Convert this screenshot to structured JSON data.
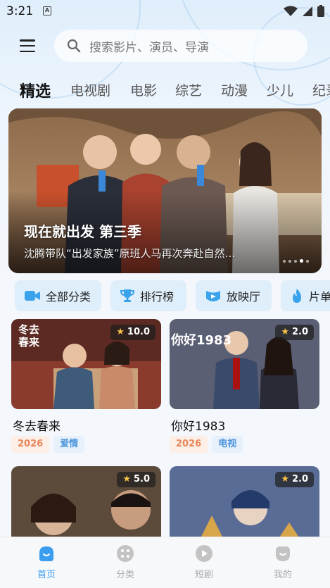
{
  "status": {
    "time": "3:21",
    "notification_badge": "A",
    "icons": [
      "wifi-icon",
      "signal-icon",
      "battery-icon"
    ]
  },
  "search": {
    "placeholder": "搜索影片、演员、导演"
  },
  "tabs": [
    {
      "label": "精选",
      "active": true
    },
    {
      "label": "电视剧"
    },
    {
      "label": "电影"
    },
    {
      "label": "综艺"
    },
    {
      "label": "动漫"
    },
    {
      "label": "少儿"
    },
    {
      "label": "纪录"
    }
  ],
  "banner": {
    "title": "现在就出发 第三季",
    "subtitle": "沈腾带队“出发家族”原班人马再次奔赴自然…",
    "slide_count": 5,
    "active_slide": 4
  },
  "quick_links": [
    {
      "label": "全部分类",
      "icon": "video-camera-icon"
    },
    {
      "label": "排行榜",
      "icon": "trophy-icon"
    },
    {
      "label": "放映厅",
      "icon": "theater-icon"
    },
    {
      "label": "片单",
      "icon": "flame-icon"
    }
  ],
  "cards": [
    {
      "title": "冬去春来",
      "rating": "10.0",
      "year": "2026",
      "genre": "爱情",
      "poster_text": "冬去春来"
    },
    {
      "title": "你好1983",
      "rating": "2.0",
      "year": "2026",
      "genre": "电视",
      "poster_text": "你好1983"
    },
    {
      "title": "",
      "rating": "5.0"
    },
    {
      "title": "",
      "rating": "2.0"
    }
  ],
  "bottom_nav": [
    {
      "label": "首页",
      "icon": "home-icon",
      "active": true
    },
    {
      "label": "分类",
      "icon": "category-icon"
    },
    {
      "label": "短剧",
      "icon": "play-icon"
    },
    {
      "label": "我的",
      "icon": "profile-icon"
    }
  ],
  "colors": {
    "accent": "#3a9df0",
    "year_tag": "#e9865a",
    "genre_tag": "#4a94db",
    "chip_bg": "#dfeefb",
    "star": "#f6c343"
  }
}
